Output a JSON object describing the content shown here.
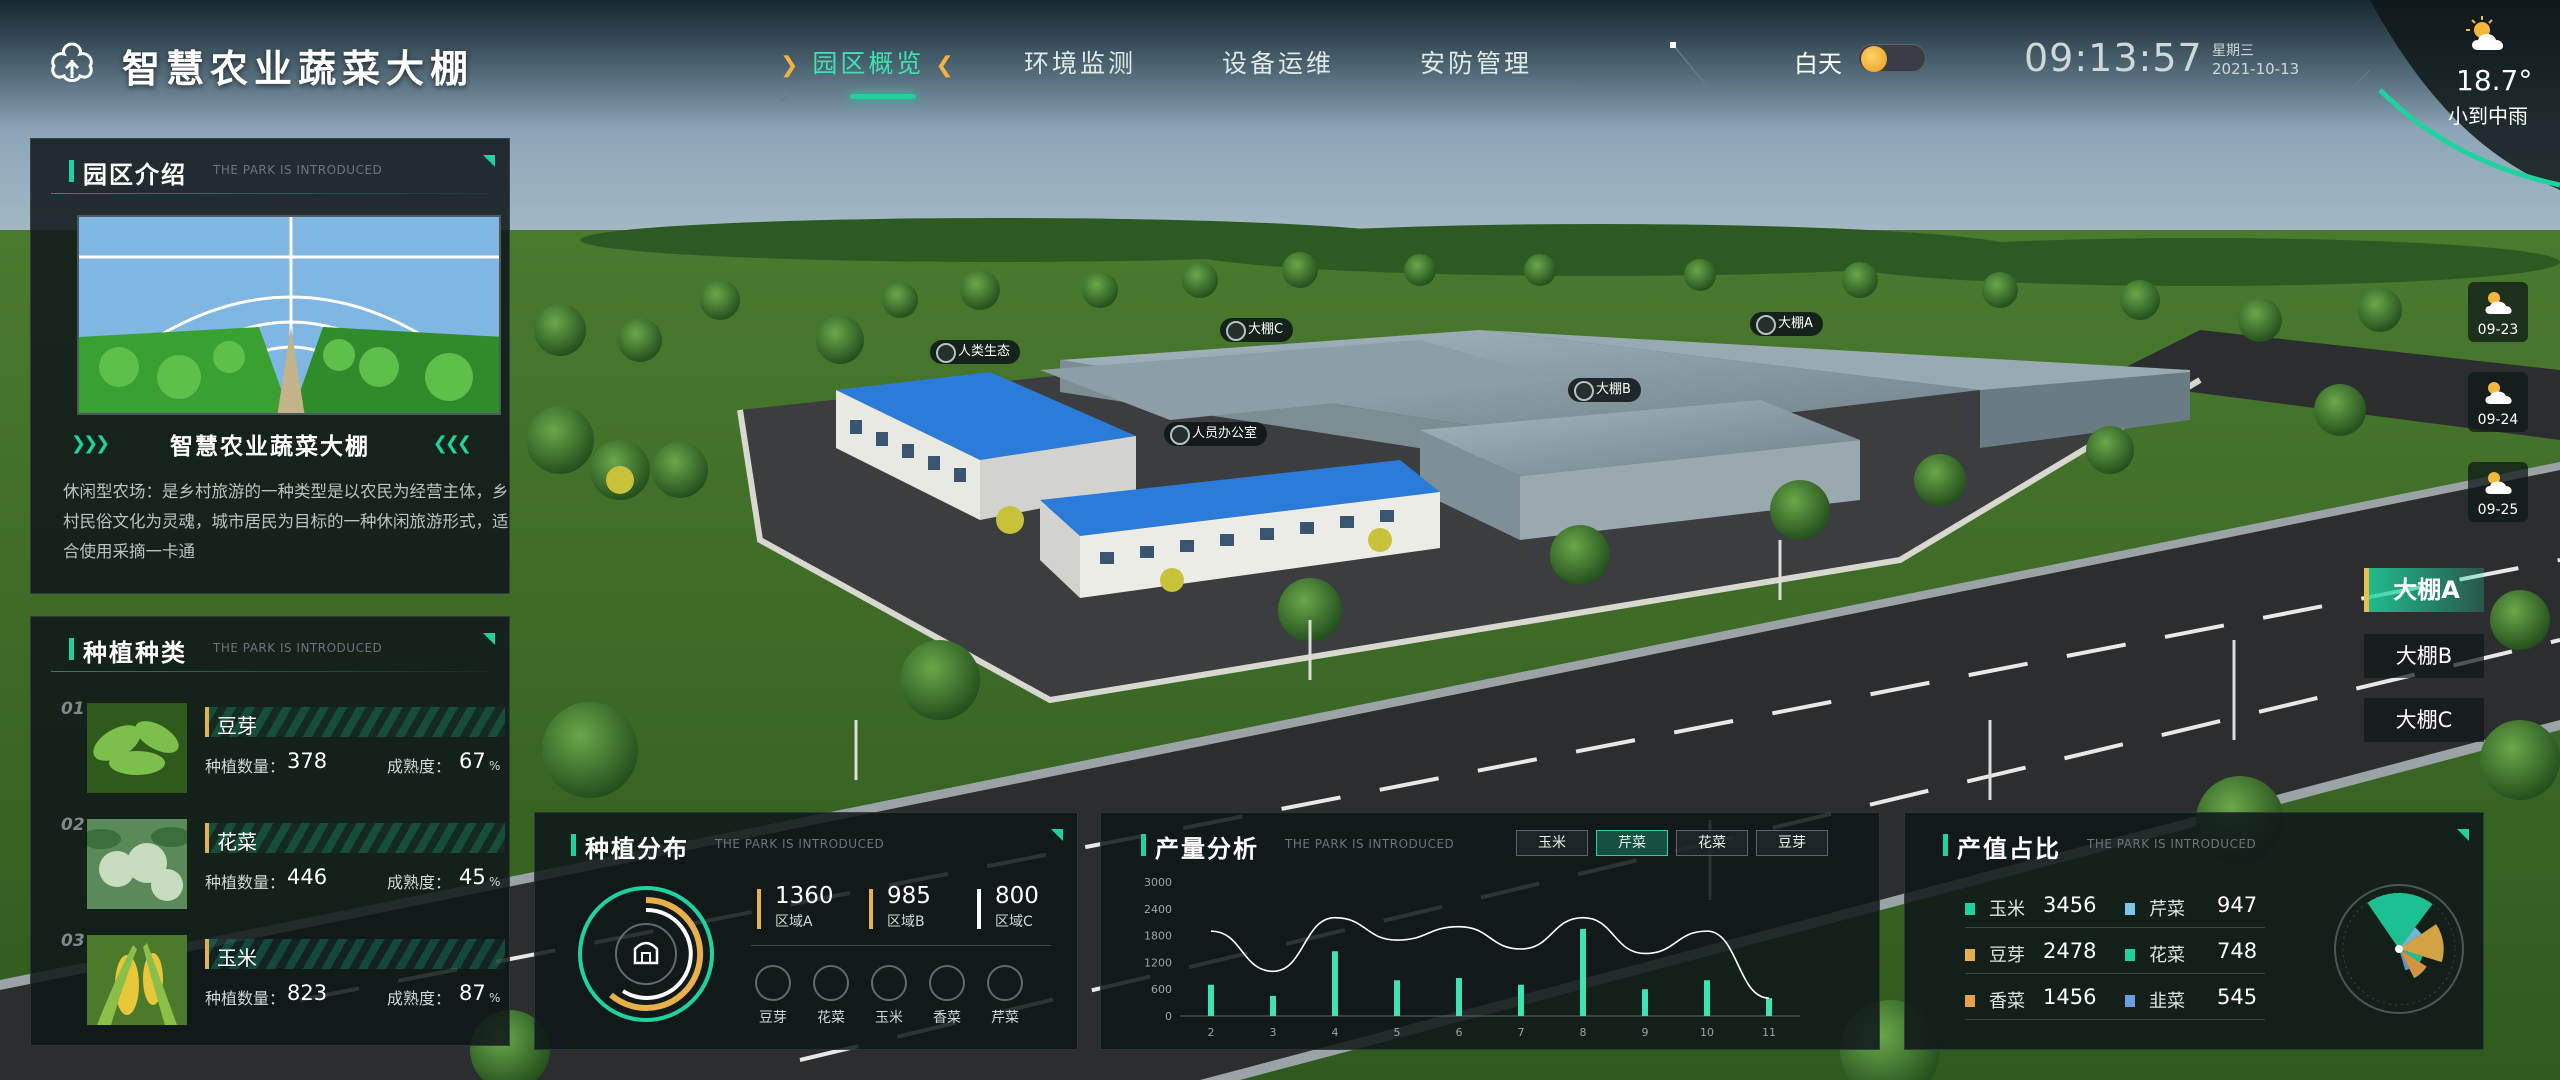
{
  "app": {
    "title": "智慧农业蔬菜大棚"
  },
  "nav": {
    "items": [
      {
        "label": "园区概览",
        "active": true
      },
      {
        "label": "环境监测",
        "active": false
      },
      {
        "label": "设备运维",
        "active": false
      },
      {
        "label": "安防管理",
        "active": false
      }
    ]
  },
  "header": {
    "daynight_label": "白天",
    "time": "09:13:57",
    "weekday": "星期三",
    "date": "2021-10-13",
    "weather": {
      "temp": "18.7°",
      "desc": "小到中雨",
      "icon": "partly-cloudy-icon"
    }
  },
  "intro": {
    "title": "园区介绍",
    "subtitle": "THE PARK IS INTRODUCED",
    "name": "智慧农业蔬菜大棚",
    "text": "休闲型农场：是乡村旅游的一种类型是以农民为经营主体，乡村民俗文化为灵魂，城市居民为目标的一种休闲旅游形式，适合使用采摘一卡通"
  },
  "crops": {
    "title": "种植种类",
    "subtitle": "THE PARK IS INTRODUCED",
    "qty_label": "种植数量：",
    "ripe_label": "成熟度：",
    "unit": "%",
    "items": [
      {
        "num": "01",
        "name": "豆芽",
        "qty": "378",
        "ripe": "67"
      },
      {
        "num": "02",
        "name": "花菜",
        "qty": "446",
        "ripe": "45"
      },
      {
        "num": "03",
        "name": "玉米",
        "qty": "823",
        "ripe": "87"
      }
    ]
  },
  "distribution": {
    "title": "种植分布",
    "subtitle": "THE PARK IS INTRODUCED",
    "regions": [
      {
        "value": "1360",
        "label": "区域A",
        "color": "#e8b04a"
      },
      {
        "value": "985",
        "label": "区域B",
        "color": "#e8b04a"
      },
      {
        "value": "800",
        "label": "区域C",
        "color": "#ffffff"
      }
    ],
    "vegetables": [
      "豆芽",
      "花菜",
      "玉米",
      "香菜",
      "芹菜"
    ]
  },
  "output": {
    "title": "产量分析",
    "subtitle": "THE PARK IS INTRODUCED",
    "filters": [
      {
        "label": "玉米",
        "active": false
      },
      {
        "label": "芹菜",
        "active": true
      },
      {
        "label": "花菜",
        "active": false
      },
      {
        "label": "豆芽",
        "active": false
      }
    ]
  },
  "chart_data": {
    "type": "bar",
    "categories": [
      "2",
      "3",
      "4",
      "5",
      "6",
      "7",
      "8",
      "9",
      "10",
      "11"
    ],
    "y_ticks": [
      "0",
      "600",
      "1200",
      "1800",
      "2400",
      "3000"
    ],
    "ylim": [
      0,
      3000
    ],
    "series": [
      {
        "type": "bar",
        "values": [
          700,
          450,
          1450,
          800,
          850,
          700,
          1950,
          600,
          800,
          400
        ]
      },
      {
        "type": "line",
        "values": [
          1900,
          1000,
          2200,
          1700,
          2000,
          1500,
          2200,
          1400,
          1900,
          400
        ]
      }
    ],
    "colors": {
      "bar": "#3ee3b3",
      "line": "#ffffff"
    }
  },
  "share": {
    "title": "产值占比",
    "subtitle": "THE PARK IS INTRODUCED",
    "items": [
      {
        "name": "玉米",
        "value": "3456",
        "color": "#1fd39e"
      },
      {
        "name": "芹菜",
        "value": "947",
        "color": "#7ec6e8"
      },
      {
        "name": "豆芽",
        "value": "2478",
        "color": "#e8b04a"
      },
      {
        "name": "花菜",
        "value": "748",
        "color": "#1fd39e"
      },
      {
        "name": "香菜",
        "value": "1456",
        "color": "#e8a04a"
      },
      {
        "name": "韭菜",
        "value": "545",
        "color": "#6a9ee0"
      }
    ]
  },
  "forecast": [
    {
      "date": "09-23"
    },
    {
      "date": "09-24"
    },
    {
      "date": "09-25"
    }
  ],
  "sheds": [
    {
      "label": "大棚A",
      "active": true
    },
    {
      "label": "大棚B",
      "active": false
    },
    {
      "label": "大棚C",
      "active": false
    }
  ],
  "scene_tags": [
    "人类生态",
    "大棚C",
    "大棚A",
    "人员办公室",
    "大棚B"
  ]
}
